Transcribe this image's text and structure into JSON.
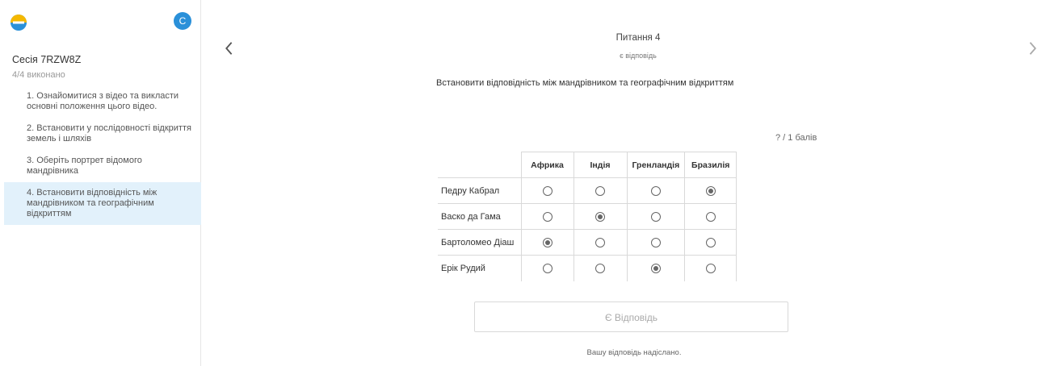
{
  "sidebar": {
    "avatar_letter": "C",
    "session_title": "Сесія 7RZW8Z",
    "session_progress": "4/4 виконано",
    "tasks": [
      {
        "num": "1.",
        "text": "Ознайомитися з відео та викласти основні положення цього відео."
      },
      {
        "num": "2.",
        "text": "Встановити у послідовності відкриття земель і шляхів"
      },
      {
        "num": "3.",
        "text": "Оберіть портрет відомого мандрівника"
      },
      {
        "num": "4.",
        "text": "Встановити відповідність між мандрівником та географічним відкриттям"
      }
    ],
    "active_task_index": 3
  },
  "nav": {
    "prev_icon": "chevron-left-icon",
    "next_icon": "chevron-right-icon"
  },
  "question": {
    "title": "Питання 4",
    "subtitle": "є відповідь",
    "text": "Встановити відповідність між мандрівником та географічним відкриттям",
    "score": "? / 1 балів"
  },
  "matrix": {
    "columns": [
      "Африка",
      "Індія",
      "Гренландія",
      "Бразилія"
    ],
    "rows": [
      {
        "label": "Педру Кабрал",
        "selected": 3
      },
      {
        "label": "Васко да Гама",
        "selected": 1
      },
      {
        "label": "Бартоломео Діаш",
        "selected": 0
      },
      {
        "label": "Ерік Рудий",
        "selected": 2
      }
    ]
  },
  "footer": {
    "answer_button": "Є Відповідь",
    "submitted_text": "Вашу відповідь надіслано."
  },
  "colors": {
    "accent": "#2a90d9",
    "active_task_bg": "#e2f1fb"
  }
}
